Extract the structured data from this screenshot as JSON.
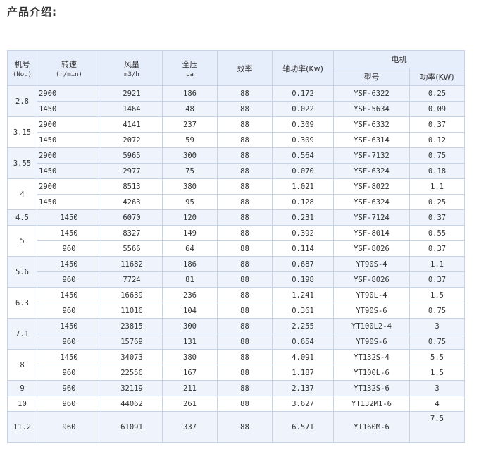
{
  "title": "产品介绍:",
  "header": {
    "machine_no": "机号",
    "machine_no_unit": "(No.)",
    "speed": "转速",
    "speed_unit": "(r/min)",
    "airflow": "风量",
    "airflow_unit": "m3/h",
    "pressure": "全压",
    "pressure_unit": "pa",
    "efficiency": "效率",
    "shaft_power": "轴功率(Kw)",
    "motor": "电机",
    "model": "型号",
    "power": "功率(KW)"
  },
  "groups": [
    {
      "no": "2.8",
      "rows": [
        {
          "speed": "2900",
          "airflow": "2921",
          "pressure": "186",
          "efficiency": "88",
          "shaft_power": "0.172",
          "model": "YSF-6322",
          "power": "0.25"
        },
        {
          "speed": "1450",
          "airflow": "1464",
          "pressure": "48",
          "efficiency": "88",
          "shaft_power": "0.022",
          "model": "YSF-5634",
          "power": "0.09"
        }
      ]
    },
    {
      "no": "3.15",
      "rows": [
        {
          "speed": "2900",
          "airflow": "4141",
          "pressure": "237",
          "efficiency": "88",
          "shaft_power": "0.309",
          "model": "YSF-6332",
          "power": "0.37"
        },
        {
          "speed": "1450",
          "airflow": "2072",
          "pressure": "59",
          "efficiency": "88",
          "shaft_power": "0.309",
          "model": "YSF-6314",
          "power": "0.12"
        }
      ]
    },
    {
      "no": "3.55",
      "rows": [
        {
          "speed": "2900",
          "airflow": "5965",
          "pressure": "300",
          "efficiency": "88",
          "shaft_power": "0.564",
          "model": "YSF-7132",
          "power": "0.75"
        },
        {
          "speed": "1450",
          "airflow": "2977",
          "pressure": "75",
          "efficiency": "88",
          "shaft_power": "0.070",
          "model": "YSF-6324",
          "power": "0.18"
        }
      ]
    },
    {
      "no": "4",
      "rows": [
        {
          "speed": "2900",
          "airflow": "8513",
          "pressure": "380",
          "efficiency": "88",
          "shaft_power": "1.021",
          "model": "YSF-8022",
          "power": "1.1"
        },
        {
          "speed": "1450",
          "airflow": "4263",
          "pressure": "95",
          "efficiency": "88",
          "shaft_power": "0.128",
          "model": "YSF-6324",
          "power": "0.25"
        }
      ]
    },
    {
      "no": "4.5",
      "rows": [
        {
          "speed": "1450",
          "airflow": "6070",
          "pressure": "120",
          "efficiency": "88",
          "shaft_power": "0.231",
          "model": "YSF-7124",
          "power": "0.37"
        }
      ]
    },
    {
      "no": "5",
      "rows": [
        {
          "speed": "1450",
          "airflow": "8327",
          "pressure": "149",
          "efficiency": "88",
          "shaft_power": "0.392",
          "model": "YSF-8014",
          "power": "0.55"
        },
        {
          "speed": "960",
          "airflow": "5566",
          "pressure": "64",
          "efficiency": "88",
          "shaft_power": "0.114",
          "model": "YSF-8026",
          "power": "0.37"
        }
      ]
    },
    {
      "no": "5.6",
      "rows": [
        {
          "speed": "1450",
          "airflow": "11682",
          "pressure": "186",
          "efficiency": "88",
          "shaft_power": "0.687",
          "model": "YT90S-4",
          "power": "1.1"
        },
        {
          "speed": "960",
          "airflow": "7724",
          "pressure": "81",
          "efficiency": "88",
          "shaft_power": "0.198",
          "model": "YSF-8026",
          "power": "0.37"
        }
      ]
    },
    {
      "no": "6.3",
      "rows": [
        {
          "speed": "1450",
          "airflow": "16639",
          "pressure": "236",
          "efficiency": "88",
          "shaft_power": "1.241",
          "model": "YT90L-4",
          "power": "1.5"
        },
        {
          "speed": "960",
          "airflow": "11016",
          "pressure": "104",
          "efficiency": "88",
          "shaft_power": "0.361",
          "model": "YT90S-6",
          "power": "0.75"
        }
      ]
    },
    {
      "no": "7.1",
      "rows": [
        {
          "speed": "1450",
          "airflow": "23815",
          "pressure": "300",
          "efficiency": "88",
          "shaft_power": "2.255",
          "model": "YT100L2-4",
          "power": "3"
        },
        {
          "speed": "960",
          "airflow": "15769",
          "pressure": "131",
          "efficiency": "88",
          "shaft_power": "0.654",
          "model": "YT90S-6",
          "power": "0.75"
        }
      ]
    },
    {
      "no": "8",
      "rows": [
        {
          "speed": "1450",
          "airflow": "34073",
          "pressure": "380",
          "efficiency": "88",
          "shaft_power": "4.091",
          "model": "YT132S-4",
          "power": "5.5"
        },
        {
          "speed": "960",
          "airflow": "22556",
          "pressure": "167",
          "efficiency": "88",
          "shaft_power": "1.187",
          "model": "YT100L-6",
          "power": "1.5"
        }
      ]
    },
    {
      "no": "9",
      "rows": [
        {
          "speed": "960",
          "airflow": "32119",
          "pressure": "211",
          "efficiency": "88",
          "shaft_power": "2.137",
          "model": "YT132S-6",
          "power": "3"
        }
      ]
    },
    {
      "no": "10",
      "rows": [
        {
          "speed": "960",
          "airflow": "44062",
          "pressure": "261",
          "efficiency": "88",
          "shaft_power": "3.627",
          "model": "YT132M1-6",
          "power": "4"
        }
      ]
    },
    {
      "no": "11.2",
      "rows": [
        {
          "speed": "960",
          "airflow": "61091",
          "pressure": "337",
          "efficiency": "88",
          "shaft_power": "6.571",
          "model": "YT160M-6",
          "power": "7.5"
        }
      ]
    }
  ]
}
